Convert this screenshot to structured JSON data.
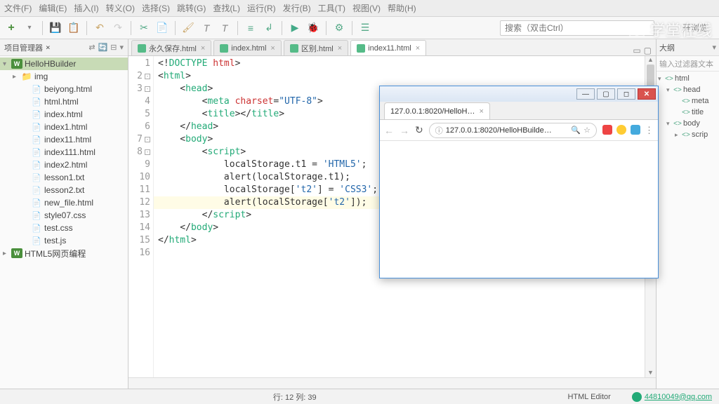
{
  "menu": [
    "文件(F)",
    "编辑(E)",
    "插入(I)",
    "转义(O)",
    "选择(S)",
    "跳转(G)",
    "查找(L)",
    "运行(R)",
    "发行(B)",
    "工具(T)",
    "视图(V)",
    "帮助(H)"
  ],
  "toolbar": {
    "search_ph": "搜索（双击Ctrl）"
  },
  "watermark": "学堂在线",
  "project_explorer": {
    "title": "项目管理器",
    "items": [
      {
        "label": "HelloHBuilder",
        "icon": "w",
        "indent": 0,
        "expand": "▾",
        "sel": true
      },
      {
        "label": "img",
        "icon": "folder",
        "indent": 1,
        "expand": "▸"
      },
      {
        "label": "beiyong.html",
        "icon": "html",
        "indent": 2
      },
      {
        "label": "html.html",
        "icon": "html",
        "indent": 2
      },
      {
        "label": "index.html",
        "icon": "html",
        "indent": 2
      },
      {
        "label": "index1.html",
        "icon": "html",
        "indent": 2
      },
      {
        "label": "index11.html",
        "icon": "html",
        "indent": 2
      },
      {
        "label": "index111.html",
        "icon": "html",
        "indent": 2
      },
      {
        "label": "index2.html",
        "icon": "html",
        "indent": 2
      },
      {
        "label": "lesson1.txt",
        "icon": "txt",
        "indent": 2
      },
      {
        "label": "lesson2.txt",
        "icon": "txt",
        "indent": 2
      },
      {
        "label": "new_file.html",
        "icon": "html",
        "indent": 2
      },
      {
        "label": "style07.css",
        "icon": "css",
        "indent": 2
      },
      {
        "label": "test.css",
        "icon": "css",
        "indent": 2
      },
      {
        "label": "test.js",
        "icon": "js",
        "indent": 2
      },
      {
        "label": "HTML5网页编程",
        "icon": "w",
        "indent": 0,
        "expand": "▸"
      }
    ]
  },
  "tabs": [
    {
      "label": "永久保存.html"
    },
    {
      "label": "index.html"
    },
    {
      "label": "区别.html"
    },
    {
      "label": "index11.html",
      "active": true
    }
  ],
  "code": {
    "highlight_line": 12,
    "lines": [
      {
        "n": 1,
        "fold": "",
        "html": "&lt;!<span class='c-tag'>DOCTYPE</span> <span class='c-attr'>html</span>&gt;"
      },
      {
        "n": 2,
        "fold": "⊟",
        "html": "&lt;<span class='c-tag'>html</span>&gt;"
      },
      {
        "n": 3,
        "fold": "⊟",
        "html": "    &lt;<span class='c-tag'>head</span>&gt;"
      },
      {
        "n": 4,
        "fold": "",
        "html": "        &lt;<span class='c-tag'>meta</span> <span class='c-attr'>charset</span>=<span class='c-str'>\"UTF-8\"</span>&gt;"
      },
      {
        "n": 5,
        "fold": "",
        "html": "        &lt;<span class='c-tag'>title</span>&gt;&lt;/<span class='c-tag'>title</span>&gt;"
      },
      {
        "n": 6,
        "fold": "",
        "html": "    &lt;/<span class='c-tag'>head</span>&gt;"
      },
      {
        "n": 7,
        "fold": "⊟",
        "html": "    &lt;<span class='c-tag'>body</span>&gt;"
      },
      {
        "n": 8,
        "fold": "⊟",
        "html": "        &lt;<span class='c-tag'>script</span>&gt;"
      },
      {
        "n": 9,
        "fold": "",
        "html": "            localStorage.t1 = <span class='c-lit'>'HTML5'</span>;"
      },
      {
        "n": 10,
        "fold": "",
        "html": "            alert(localStorage.t1);"
      },
      {
        "n": 11,
        "fold": "",
        "html": "            localStorage[<span class='c-lit'>'t2'</span>] = <span class='c-lit'>'CSS3'</span>;"
      },
      {
        "n": 12,
        "fold": "",
        "html": "            alert(localStorage[<span class='c-lit'>'t2'</span>]);"
      },
      {
        "n": 13,
        "fold": "",
        "html": "        &lt;/<span class='c-tag'>script</span>&gt;"
      },
      {
        "n": 14,
        "fold": "",
        "html": "    &lt;/<span class='c-tag'>body</span>&gt;"
      },
      {
        "n": 15,
        "fold": "",
        "html": "&lt;/<span class='c-tag'>html</span>&gt;"
      },
      {
        "n": 16,
        "fold": "",
        "html": ""
      }
    ]
  },
  "outline": {
    "title": "大纲",
    "filter_ph": "输入过滤器文本",
    "items": [
      {
        "label": "html",
        "lvl": 0,
        "tw": "▾"
      },
      {
        "label": "head",
        "lvl": 1,
        "tw": "▾"
      },
      {
        "label": "meta",
        "lvl": 2,
        "tw": ""
      },
      {
        "label": "title",
        "lvl": 2,
        "tw": ""
      },
      {
        "label": "body",
        "lvl": 1,
        "tw": "▾"
      },
      {
        "label": "scrip",
        "lvl": 2,
        "tw": "▸"
      }
    ]
  },
  "status": {
    "pos": "行: 12 列: 39",
    "mode": "HTML Editor",
    "user": "44810049@qq.com"
  },
  "browser": {
    "tab": "127.0.0.1:8020/HelloH…",
    "url": "127.0.0.1:8020/HelloHBuilde…",
    "nav": {
      "back": "←",
      "fwd": "→",
      "reload": "↻"
    },
    "icons": {
      "info": "ⓘ",
      "search": "🔍",
      "star": "☆"
    }
  },
  "right_header": {
    "label": "开浏览"
  }
}
